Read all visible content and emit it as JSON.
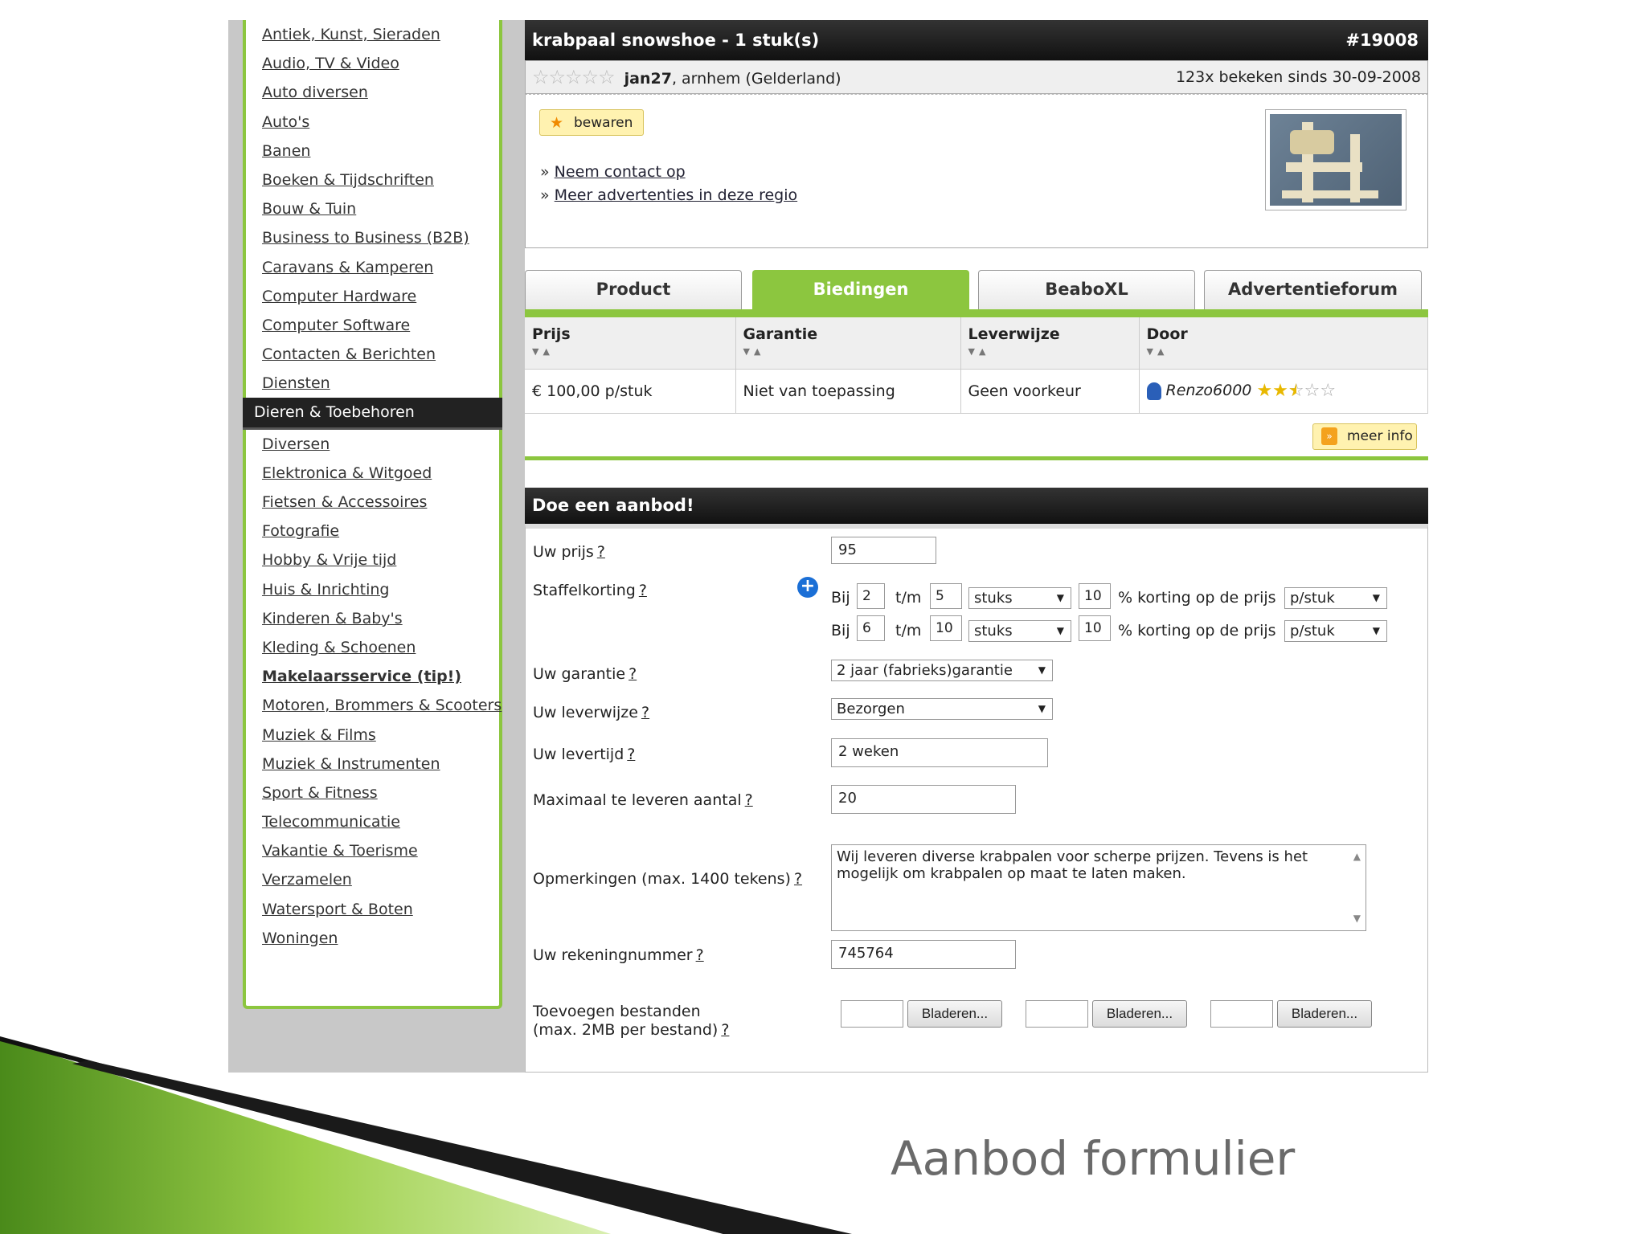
{
  "sidebar": {
    "items": [
      {
        "label": "Antiek, Kunst, Sieraden"
      },
      {
        "label": "Audio, TV & Video"
      },
      {
        "label": "Auto diversen"
      },
      {
        "label": "Auto's"
      },
      {
        "label": "Banen"
      },
      {
        "label": "Boeken & Tijdschriften"
      },
      {
        "label": "Bouw & Tuin"
      },
      {
        "label": "Business to Business (B2B)"
      },
      {
        "label": "Caravans & Kamperen"
      },
      {
        "label": "Computer Hardware"
      },
      {
        "label": "Computer Software"
      },
      {
        "label": "Contacten & Berichten"
      },
      {
        "label": "Diensten"
      },
      {
        "label": "Dieren & Toebehoren"
      },
      {
        "label": "Diversen"
      },
      {
        "label": "Elektronica & Witgoed"
      },
      {
        "label": "Fietsen & Accessoires"
      },
      {
        "label": "Fotografie"
      },
      {
        "label": "Hobby & Vrije tijd"
      },
      {
        "label": "Huis & Inrichting"
      },
      {
        "label": "Kinderen & Baby's"
      },
      {
        "label": "Kleding & Schoenen"
      },
      {
        "label": "Makelaarsservice (tip!)"
      },
      {
        "label": "Motoren, Brommers & Scooters"
      },
      {
        "label": "Muziek & Films"
      },
      {
        "label": "Muziek & Instrumenten"
      },
      {
        "label": "Sport & Fitness"
      },
      {
        "label": "Telecommunicatie"
      },
      {
        "label": "Vakantie & Toerisme"
      },
      {
        "label": "Verzamelen"
      },
      {
        "label": "Watersport & Boten"
      },
      {
        "label": "Woningen"
      }
    ],
    "active": "Dieren & Toebehoren"
  },
  "ad": {
    "title": "krabpaal snowshoe - 1 stuk(s)",
    "number": "#19008",
    "user": "jan27",
    "location": ", arnhem (Gelderland)",
    "views": "123x bekeken sinds 30-09-2008",
    "save_label": "bewaren",
    "contact_link": "Neem contact op",
    "region_link": "Meer advertenties in deze regio"
  },
  "tabs": [
    {
      "label": "Product"
    },
    {
      "label": "Biedingen"
    },
    {
      "label": "BeaboXL"
    },
    {
      "label": "Advertentieforum"
    }
  ],
  "bids": {
    "headers": [
      "Prijs",
      "Garantie",
      "Leverwijze",
      "Door"
    ],
    "row": {
      "price": "€ 100,00 p/stuk",
      "warranty": "Niet van toepassing",
      "delivery": "Geen voorkeur",
      "bidder": "Renzo6000",
      "bidder_rating": 2.5
    },
    "more_info": "meer info"
  },
  "form": {
    "title": "Doe een aanbod!",
    "help": "?",
    "price_label": "Uw prijs",
    "price_value": "95",
    "staffel_label": "Staffelkorting",
    "staffel_rows": [
      {
        "bij": "Bij",
        "from": "2",
        "tm": "t/m",
        "to": "5",
        "unit": "stuks",
        "pct": "10",
        "text": "% korting op de prijs",
        "per": "p/stuk"
      },
      {
        "bij": "Bij",
        "from": "6",
        "tm": "t/m",
        "to": "10",
        "unit": "stuks",
        "pct": "10",
        "text": "% korting op de prijs",
        "per": "p/stuk"
      }
    ],
    "warranty_label": "Uw garantie",
    "warranty_value": "2 jaar (fabrieks)garantie",
    "delivery_label": "Uw leverwijze",
    "delivery_value": "Bezorgen",
    "leadtime_label": "Uw levertijd",
    "leadtime_value": "2 weken",
    "max_label": "Maximaal te leveren aantal",
    "max_value": "20",
    "remarks_label": "Opmerkingen (max. 1400 tekens)",
    "remarks_value": "Wij leveren diverse krabpalen voor scherpe prijzen. Tevens is het mogelijk om krabpalen op maat te laten maken.",
    "account_label": "Uw rekeningnummer",
    "account_value": "745764",
    "files_label_1": "Toevoegen bestanden",
    "files_label_2": "(max. 2MB per bestand)",
    "browse_label": "Bladeren..."
  },
  "caption": "Aanbod formulier",
  "colors": {
    "accent": "#8cc63f",
    "header": "#1a1a1a",
    "highlight": "#fff2b0"
  }
}
